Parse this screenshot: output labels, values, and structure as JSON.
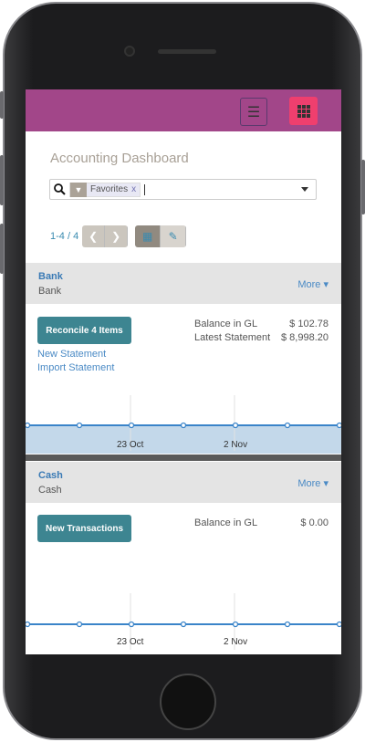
{
  "app": {
    "title": "Accounting Dashboard"
  },
  "search": {
    "facet": "Favorites",
    "facet_remove": "x"
  },
  "pager": {
    "range": "1-4 / 4"
  },
  "journals": [
    {
      "name": "Bank",
      "type": "Bank",
      "more": "More",
      "action": "Reconcile 4 Items",
      "links": [
        "New Statement",
        "Import Statement"
      ],
      "stats": [
        {
          "label": "Balance in GL",
          "value": "$ 102.78"
        },
        {
          "label": "Latest Statement",
          "value": "$ 8,998.20"
        }
      ],
      "chart_labels": [
        "23 Oct",
        "2 Nov"
      ]
    },
    {
      "name": "Cash",
      "type": "Cash",
      "more": "More",
      "action": "New Transactions",
      "stats": [
        {
          "label": "Balance in GL",
          "value": "$ 0.00"
        }
      ],
      "chart_labels": [
        "23 Oct",
        "2 Nov"
      ]
    }
  ],
  "colors": {
    "topbar": "#a24689",
    "apps": "#ef3f6e",
    "primary": "#3d8591",
    "link": "#4a8ac5"
  }
}
